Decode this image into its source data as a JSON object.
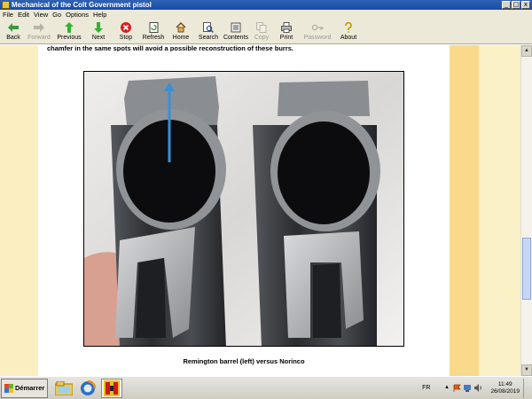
{
  "window": {
    "title": "Mechanical of the Colt Government pistol"
  },
  "window_buttons": [
    "_",
    "□",
    "x"
  ],
  "menu": [
    "File",
    "Edit",
    "View",
    "Go",
    "Options",
    "Help"
  ],
  "toolbar": [
    {
      "label": "Back",
      "icon": "back-arrow-icon",
      "enabled": true
    },
    {
      "label": "Forward",
      "icon": "forward-arrow-icon",
      "enabled": false
    },
    {
      "label": "Previous",
      "icon": "up-arrow-icon",
      "enabled": true
    },
    {
      "label": "Next",
      "icon": "down-arrow-icon",
      "enabled": true
    },
    {
      "label": "Stop",
      "icon": "stop-icon",
      "enabled": true
    },
    {
      "label": "Refresh",
      "icon": "refresh-icon",
      "enabled": true
    },
    {
      "label": "Home",
      "icon": "home-icon",
      "enabled": true
    },
    {
      "label": "Search",
      "icon": "search-icon",
      "enabled": true
    },
    {
      "label": "Contents",
      "icon": "contents-icon",
      "enabled": true
    },
    {
      "label": "Copy",
      "icon": "copy-icon",
      "enabled": false
    },
    {
      "label": "Print",
      "icon": "print-icon",
      "enabled": true
    },
    {
      "label": "Password",
      "icon": "key-icon",
      "enabled": false
    },
    {
      "label": "About",
      "icon": "help-icon",
      "enabled": true
    }
  ],
  "content": {
    "top_text": "chamfer in the same spots will avoid a possible reconstruction of these burrs.",
    "caption": "Remington barrel (left) versus Norinco"
  },
  "taskbar": {
    "start_label": "Démarrer",
    "language": "FR",
    "time": "11:49",
    "date": "26/08/2019"
  },
  "colors": {
    "titlebar": "#1a4ba4",
    "page_left_band": "#fbeec0",
    "page_right_band": "#f9d98a",
    "arrow_annotation": "#3b8fd4"
  }
}
